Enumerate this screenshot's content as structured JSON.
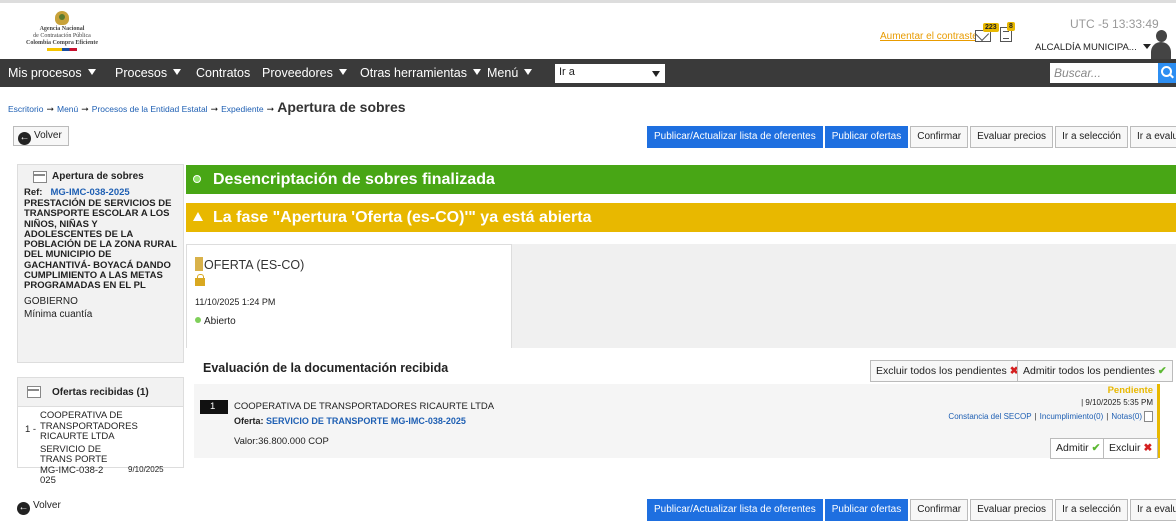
{
  "header": {
    "logo_line1": "Agencia Nacional",
    "logo_line2": "de Contratación Pública",
    "logo_line3": "Colombia Compra Eficiente",
    "contrast_link": "Aumentar el contraste",
    "mail_badge": "223",
    "doc_badge": "8",
    "utc_label": "UTC -5",
    "time": "13:33:49",
    "org": "ALCALDÍA MUNICIPA..."
  },
  "nav": {
    "items": [
      "Mis procesos",
      "Procesos",
      "Contratos",
      "Proveedores",
      "Otras herramientas",
      "Menú"
    ],
    "goto_select": "Ir a",
    "search_placeholder": "Buscar..."
  },
  "breadcrumb": {
    "items": [
      "Escritorio",
      "Menú",
      "Procesos de la Entidad Estatal",
      "Expediente"
    ],
    "current": "Apertura de sobres"
  },
  "toolbar": {
    "back": "Volver",
    "buttons": [
      "Publicar/Actualizar lista de oferentes",
      "Publicar ofertas",
      "Confirmar",
      "Evaluar precios",
      "Ir a selección",
      "Ir a evaluar"
    ]
  },
  "sidebar": {
    "panel_title": "Apertura de sobres",
    "ref_label": "Ref:",
    "ref_value": "MG-IMC-038-2025",
    "description": "PRESTACIÓN DE SERVICIOS DE TRANSPORTE ESCOLAR A LOS NIÑOS, NIÑAS Y ADOLESCENTES DE LA POBLACIÓN DE LA ZONA RURAL DEL MUNICIPIO DE GACHANTIVÁ- BOYACÁ DANDO CUMPLIMIENTO A LAS METAS PROGRAMADAS EN EL PL",
    "entity_type": "GOBIERNO",
    "modality": "Mínima cuantía",
    "offers_title": "Ofertas recibidas (1)",
    "offer_number": "1 -",
    "offer_name": "COOPERATIVA DE TRANSPORTADORES RICAURTE LTDA",
    "offer_service": "SERVICIO DE TRANS PORTE MG-IMC-038-2 025",
    "offer_date": "9/10/2025"
  },
  "banners": {
    "success": "Desencriptación de sobres finalizada",
    "warning": "La fase \"Apertura 'Oferta (es-CO)'\" ya está abierta"
  },
  "phase": {
    "title": "OFERTA (ES-CO)",
    "date": "11/10/2025 1:24 PM",
    "status": "Abierto"
  },
  "evaluation": {
    "heading": "Evaluación de la documentación recibida",
    "exclude_all": "Excluir todos los pendientes",
    "admit_all": "Admitir todos los pendientes",
    "row_number": "1",
    "company": "COOPERATIVA DE TRANSPORTADORES RICAURTE LTDA",
    "offer_label": "Oferta:",
    "offer_link": "SERVICIO DE TRANSPORTE MG-IMC-038-2025",
    "value": "Valor:36.800.000 COP",
    "status": "Pendiente",
    "date": "| 9/10/2025 5:35 PM",
    "link_secop": "Constancia del SECOP",
    "link_breach": "Incumplimiento(0)",
    "link_notes": "Notas(0)",
    "admit": "Admitir",
    "exclude": "Excluir"
  },
  "colors": {
    "nav_bg": "#3a3a3a",
    "success_bg": "#48a615",
    "warning_bg": "#e8b800",
    "primary_button": "#1e6fe0"
  }
}
